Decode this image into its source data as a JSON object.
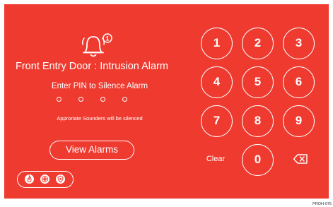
{
  "alarm": {
    "count": "1",
    "title": "Front Entry Door : Intrusion Alarm",
    "pin_prompt": "Enter PIN to Silence Alarm",
    "pin_entered": 0,
    "pin_length": 4,
    "sounder_note": "Approriate Sounders will be silenced"
  },
  "actions": {
    "view_alarms_label": "View Alarms"
  },
  "alarm_types": [
    "fire-icon",
    "medical-icon",
    "police-icon"
  ],
  "keypad": {
    "digits": [
      "1",
      "2",
      "3",
      "4",
      "5",
      "6",
      "7",
      "8",
      "9"
    ],
    "zero": "0",
    "clear_label": "Clear",
    "backspace_icon": "backspace-icon"
  },
  "image_code": "PROH-075",
  "colors": {
    "background": "#ef3a2f",
    "foreground": "#ffffff"
  }
}
